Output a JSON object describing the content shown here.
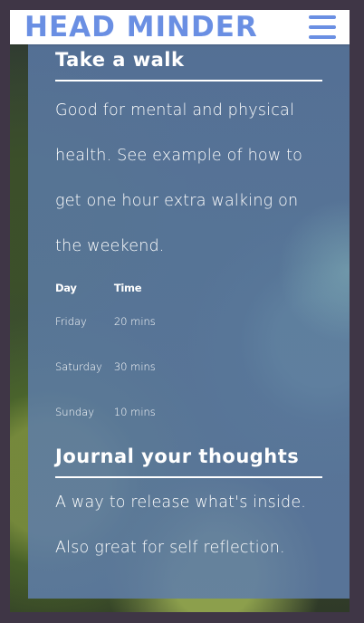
{
  "header": {
    "brand": "HEAD MINDER",
    "menu_icon": "hamburger-menu-icon",
    "brand_color": "#6a8fe3"
  },
  "walk": {
    "title": "Take a walk",
    "description": "Good for mental and physical health. See example of how to get one hour extra walking on the weekend.",
    "table": {
      "headers": [
        "Day",
        "Time"
      ],
      "rows": [
        [
          "Friday",
          "20 mins"
        ],
        [
          "Saturday",
          "30 mins"
        ],
        [
          "Sunday",
          "10 mins"
        ]
      ]
    }
  },
  "journal": {
    "title": "Journal your thoughts",
    "line1": "A way to release what's inside.",
    "line2": "Also great for self reflection."
  }
}
